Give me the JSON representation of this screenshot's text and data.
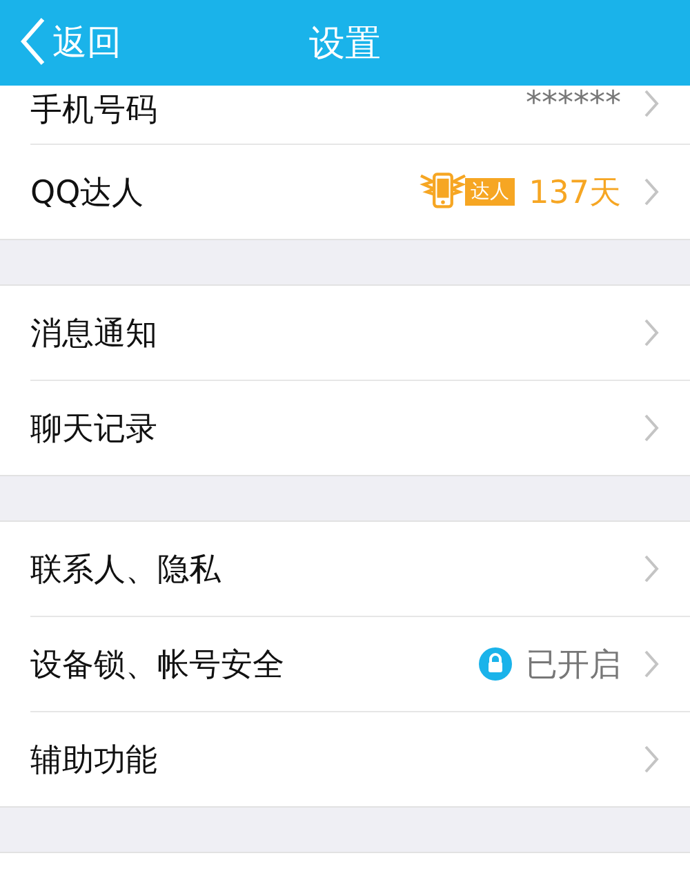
{
  "header": {
    "back_label": "返回",
    "title": "设置"
  },
  "groups": [
    {
      "rows": [
        {
          "kind": "value",
          "label": "手机号码",
          "value": "******"
        },
        {
          "kind": "badge",
          "label": "QQ达人",
          "badge": "达人",
          "value": "137天"
        }
      ]
    },
    {
      "rows": [
        {
          "kind": "plain",
          "label": "消息通知"
        },
        {
          "kind": "plain",
          "label": "聊天记录"
        }
      ]
    },
    {
      "rows": [
        {
          "kind": "plain",
          "label": "联系人、隐私"
        },
        {
          "kind": "lock",
          "label": "设备锁、帐号安全",
          "value": "已开启"
        },
        {
          "kind": "plain",
          "label": "辅助功能"
        }
      ]
    }
  ]
}
